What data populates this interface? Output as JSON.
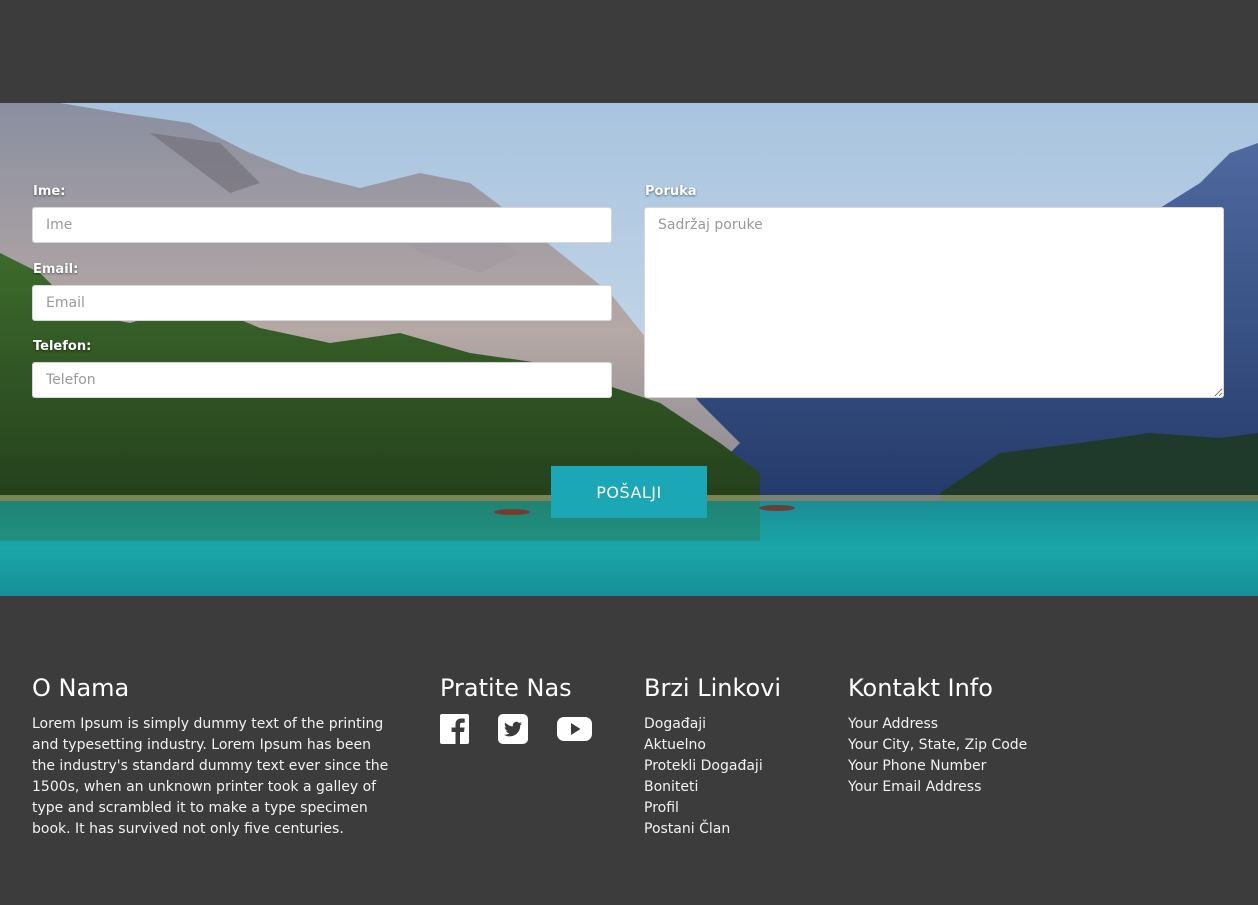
{
  "form": {
    "name_label": "Ime:",
    "name_placeholder": "Ime",
    "email_label": "Email:",
    "email_placeholder": "Email",
    "phone_label": "Telefon:",
    "phone_placeholder": "Telefon",
    "message_label": "Poruka",
    "message_placeholder": "Sadržaj poruke",
    "submit_label": "POŠALJI"
  },
  "footer": {
    "about": {
      "heading": "O Nama",
      "text": "Lorem Ipsum is simply dummy text of the printing and typesetting industry. Lorem Ipsum has been the industry's standard dummy text ever since the 1500s, when an unknown printer took a galley of type and scrambled it to make a type specimen book. It has survived not only five centuries."
    },
    "follow": {
      "heading": "Pratite Nas",
      "icons": [
        "facebook-icon",
        "twitter-icon",
        "youtube-icon"
      ]
    },
    "quick_links": {
      "heading": "Brzi Linkovi",
      "items": [
        "Događaji",
        "Aktuelno",
        "Protekli Događaji",
        "Boniteti",
        "Profil",
        "Postani Član"
      ]
    },
    "contact": {
      "heading": "Kontakt Info",
      "items": [
        "Your Address",
        "Your City, State, Zip Code",
        "Your Phone Number",
        "Your Email Address"
      ]
    }
  },
  "colors": {
    "background": "#3c3c3c",
    "accent": "#1ba7b6",
    "text": "#ffffff"
  }
}
